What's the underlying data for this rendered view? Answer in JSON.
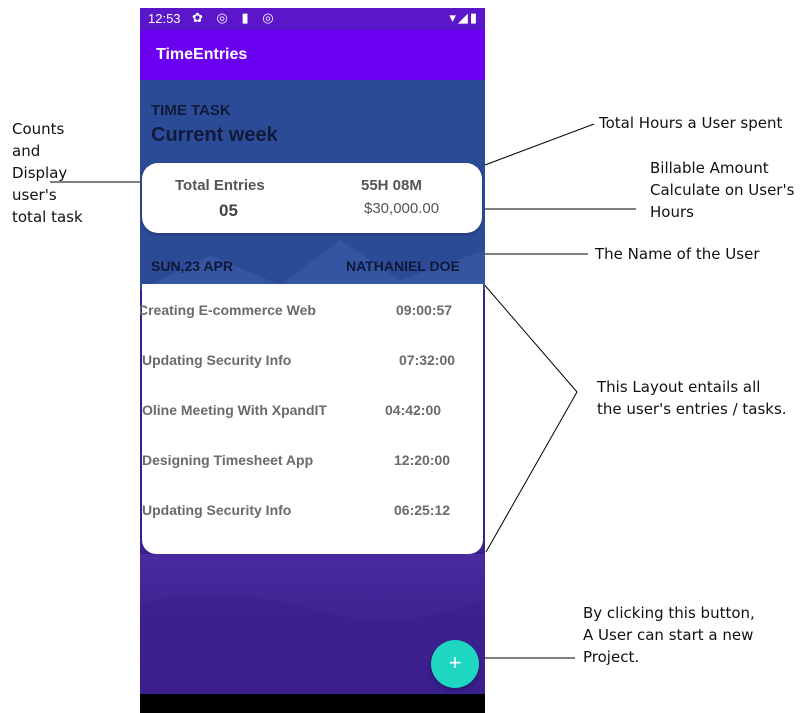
{
  "status_bar": {
    "time": "12:53",
    "left_icons": "✿ ◎ ▮ ◎",
    "right_icons": "▾◢▮"
  },
  "app_bar": {
    "title": "TimeEntries"
  },
  "header": {
    "task_label": "TIME TASK",
    "period_label": "Current week"
  },
  "summary": {
    "total_entries_label": "Total Entries",
    "total_entries_value": "05",
    "total_hours": "55H 08M",
    "billable_amount": "$30,000.00"
  },
  "day_row": {
    "date": "SUN,23 APR",
    "user_name": "NATHANIEL DOE"
  },
  "entries": [
    {
      "name": "Creating E-commerce Web",
      "duration": "09:00:57"
    },
    {
      "name": "Updating Security Info",
      "duration": "07:32:00"
    },
    {
      "name": "Oline Meeting With XpandIT",
      "duration": "04:42:00"
    },
    {
      "name": "Designing Timesheet App",
      "duration": "12:20:00"
    },
    {
      "name": "Updating Security Info",
      "duration": "06:25:12"
    }
  ],
  "fab": {
    "icon": "plus-icon",
    "symbol": "+"
  },
  "annotations": {
    "counts": "Counts\nand\nDisplay\nuser's\ntotal task",
    "total_hours": "Total Hours a User spent",
    "billable": "Billable Amount\nCalculate on User's\nHours",
    "name": "The Name of the User",
    "layout": "This Layout entails all\nthe user's entries / tasks.",
    "button": "By clicking this button,\nA User can start a new\nProject."
  },
  "colors": {
    "status_bar": "#5a16c8",
    "app_bar": "#6b00f0",
    "header": "#2c4b97",
    "fab": "#1fd6c2"
  }
}
